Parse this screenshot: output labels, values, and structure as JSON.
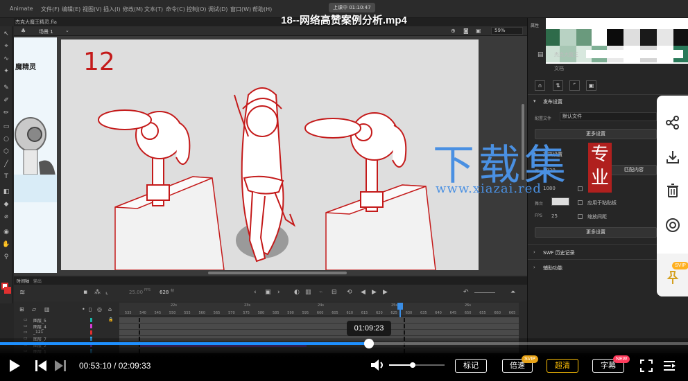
{
  "video": {
    "title": "18--网络高赞案例分析.mp4",
    "recording_badge": "上课中 01:10:47",
    "current_time": "00:53:10",
    "separator": "/",
    "duration": "02:09:33",
    "hover_time": "01:09:23",
    "progress": 0.41,
    "volume": 0.42,
    "buttons": {
      "notes": "标记",
      "speed": "倍速",
      "quality": "超清",
      "subtitle": "字幕"
    },
    "badges": {
      "speed": "SVIP",
      "subtitle": "NEW",
      "pin": "SVIP"
    }
  },
  "animate": {
    "app_name": "Animate",
    "menus": [
      "文件(F)",
      "编辑(E)",
      "视图(V)",
      "插入(I)",
      "修改(M)",
      "文本(T)",
      "命令(C)",
      "控制(O)",
      "调试(D)",
      "窗口(W)",
      "帮助(H)"
    ],
    "doc_tab": "杰克大魔王精灵.fla",
    "scene": "场景 1",
    "zoom": "59%",
    "library_caption": "魔精灵",
    "stage_annotation": "12",
    "timeline": {
      "tabs": [
        "时间轴",
        "输出"
      ],
      "fps": "25.00",
      "fps_unit": "FPS",
      "frame": "628",
      "frame_unit": "帧",
      "time_markers": [
        "22s",
        "23s",
        "24s",
        "25s",
        "26s"
      ],
      "ticks": [
        "535",
        "540",
        "545",
        "550",
        "555",
        "560",
        "565",
        "570",
        "575",
        "580",
        "585",
        "590",
        "595",
        "600",
        "605",
        "610",
        "615",
        "620",
        "625",
        "630",
        "635",
        "640",
        "645",
        "650",
        "655",
        "660",
        "665"
      ],
      "layers": [
        "图层_5",
        "图层_4",
        "_121",
        "图层_7",
        "图层_2",
        "图层_1"
      ]
    },
    "properties": {
      "doc_name": "杰克大魔王",
      "doc_type": "文档",
      "publish_section": "发布设置",
      "profile_label": "配置文件",
      "profile_value": "默认文件",
      "more_settings": "更多设置",
      "doc_settings": "文档设置",
      "width_label": "宽",
      "width_value": "1920",
      "height_value": "1080",
      "match_contents": "匹配内容",
      "stage_label": "舞台",
      "apply_paste": "应用于粘贴板",
      "fps_label": "FPS",
      "fps_value": "25",
      "scale_spacing": "缩放间距",
      "more_settings2": "更多设置",
      "swf_history": "SWF 历史记录",
      "accessibility": "辅助功能"
    }
  },
  "watermark": {
    "main": "下载集",
    "badge": "专业",
    "url": "www.xiazai.red"
  }
}
